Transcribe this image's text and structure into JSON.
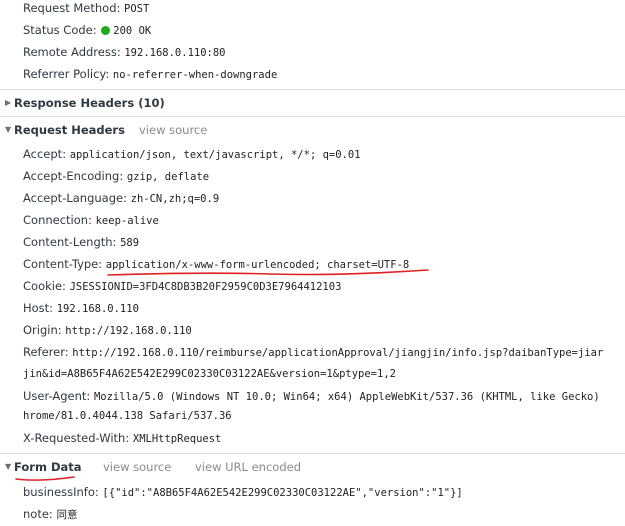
{
  "general": {
    "request_method": {
      "key": "Request Method:",
      "value": "POST"
    },
    "status_code": {
      "key": "Status Code:",
      "value": "200 OK"
    },
    "remote_address": {
      "key": "Remote Address:",
      "value": "192.168.0.110:80"
    },
    "referrer_policy": {
      "key": "Referrer Policy:",
      "value": "no-referrer-when-downgrade"
    }
  },
  "response_headers": {
    "title": "Response Headers (10)"
  },
  "request_headers": {
    "title": "Request Headers",
    "view_source": "view source",
    "items": [
      {
        "key": "Accept:",
        "value": "application/json, text/javascript, */*; q=0.01"
      },
      {
        "key": "Accept-Encoding:",
        "value": "gzip, deflate"
      },
      {
        "key": "Accept-Language:",
        "value": "zh-CN,zh;q=0.9"
      },
      {
        "key": "Connection:",
        "value": "keep-alive"
      },
      {
        "key": "Content-Length:",
        "value": "589"
      },
      {
        "key": "Content-Type:",
        "value": "application/x-www-form-urlencoded; charset=UTF-8"
      },
      {
        "key": "Cookie:",
        "value": "JSESSIONID=3FD4C8DB3B20F2959C0D3E7964412103"
      },
      {
        "key": "Host:",
        "value": "192.168.0.110"
      },
      {
        "key": "Origin:",
        "value": "http://192.168.0.110"
      }
    ],
    "referer": {
      "key": "Referer:",
      "value_line1": "http://192.168.0.110/reimburse/applicationApproval/jiangjin/info.jsp?daibanType=jiar",
      "value_line2": "jin&id=A8B65F4A62E542E299C02330C03122AE&version=1&ptype=1,2"
    },
    "user_agent": {
      "key": "User-Agent:",
      "value_line1": "Mozilla/5.0 (Windows NT 10.0; Win64; x64) AppleWebKit/537.36 (KHTML, like Gecko)",
      "value_line2": "hrome/81.0.4044.138 Safari/537.36"
    },
    "x_requested_with": {
      "key": "X-Requested-With:",
      "value": "XMLHttpRequest"
    }
  },
  "form_data": {
    "title": "Form Data",
    "view_source": "view source",
    "view_url_encoded": "view URL encoded",
    "items": [
      {
        "key": "businessInfo:",
        "value": "[{\"id\":\"A8B65F4A62E542E299C02330C03122AE\",\"version\":\"1\"}]"
      },
      {
        "key": "note:",
        "value": "同意"
      }
    ]
  },
  "colors": {
    "status_ok": "#1aad19",
    "annotation": "#e02020"
  },
  "icons": {
    "collapsed": "triangle-right-icon",
    "expanded": "triangle-down-icon"
  }
}
